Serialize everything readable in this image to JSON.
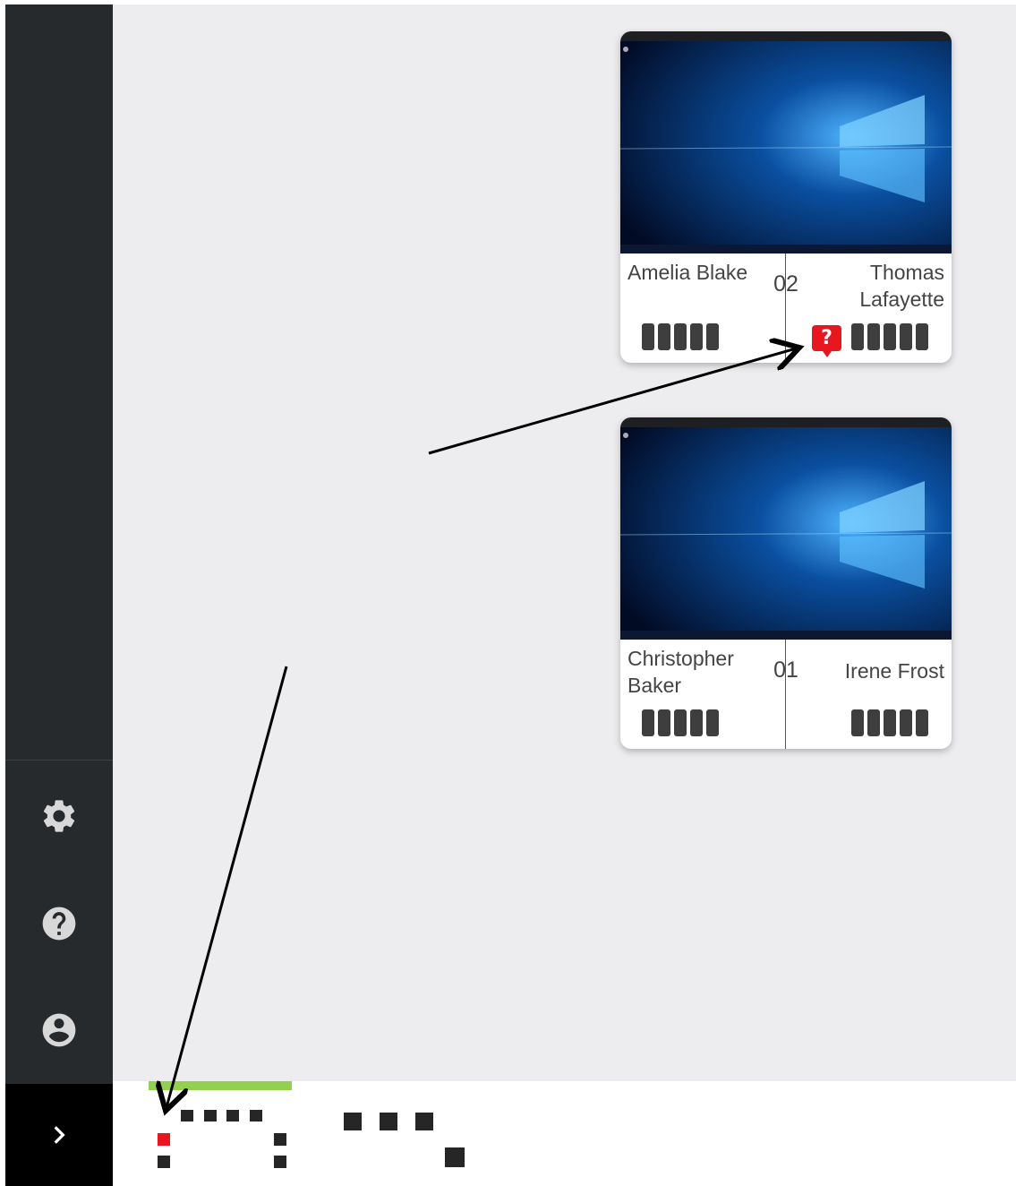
{
  "sidebar": {
    "items": [
      {
        "icon": "gear-icon"
      },
      {
        "icon": "help-circle-icon"
      },
      {
        "icon": "account-circle-icon"
      }
    ],
    "expand_icon": "chevron-right-icon"
  },
  "cards": [
    {
      "number": "02",
      "left_name": "Amelia Blake",
      "right_name": "Thomas Lafayette",
      "help_badge": "?",
      "thumbnail": "windows-desktop"
    },
    {
      "number": "01",
      "left_name": "Christopher Baker",
      "right_name": "Irene Frost",
      "thumbnail": "windows-desktop"
    }
  ],
  "colors": {
    "sidebar": "#262a2d",
    "background": "#ededef",
    "accent_green": "#92d050",
    "alert_red": "#e8161f"
  }
}
